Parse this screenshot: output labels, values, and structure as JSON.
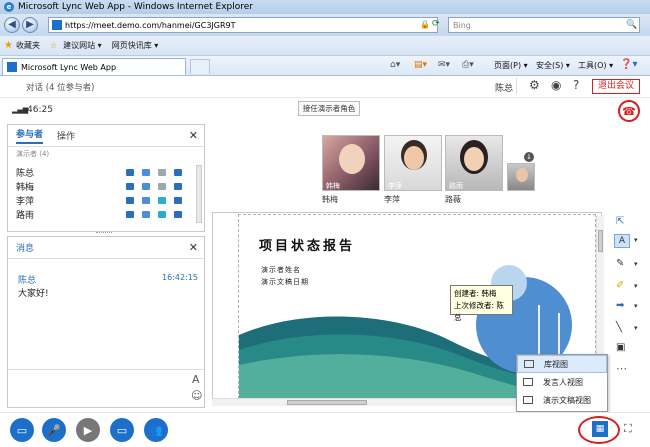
{
  "browser": {
    "window_title": "Microsoft Lync Web App - Windows Internet Explorer",
    "url": "https://meet.demo.com/hanmei/GC3JGR9T",
    "search_placeholder": "Bing",
    "favorites_label": "收藏夹",
    "fav_links": [
      "建议网站 ▾",
      "网页快讯库 ▾"
    ],
    "tab_title": "Microsoft Lync Web App",
    "commands": [
      "页面(P) ▾",
      "安全(S) ▾",
      "工具(O) ▾"
    ]
  },
  "header": {
    "conversation_title": "对话 (4 位参与者)",
    "timer": "46:25",
    "user_name": "陈总",
    "leave_label": "退出会议"
  },
  "stage_toolbar": {
    "accept_presenter_label": "接任演示者角色"
  },
  "videos": [
    {
      "name": "韩梅",
      "caption": "韩梅"
    },
    {
      "name": "李萍",
      "caption": "李萍"
    },
    {
      "name": "路薇",
      "caption": "路雨"
    }
  ],
  "participants": {
    "tab_participants": "参与者",
    "tab_actions": "操作",
    "partial_row": "演示者 (4)",
    "people": [
      "陈总",
      "韩梅",
      "李萍",
      "路雨"
    ]
  },
  "messages": {
    "title": "消息",
    "sender": "陈总",
    "time": "16:42:15",
    "text": "大家好!",
    "font_button": "A"
  },
  "slide": {
    "title": "项目状态报告",
    "line1": "演示者姓名",
    "line2": "演示文稿日期"
  },
  "tooltip": {
    "creator": "创建者: 韩梅",
    "modifier": "上次修改者: 陈总"
  },
  "view_menu": {
    "items": [
      "库视图",
      "发言人视图",
      "演示文稿视图"
    ]
  },
  "colors": {
    "accent": "#1d6fc9",
    "leave_red": "#d81e1e",
    "tab_blue": "#2b6fb8"
  }
}
